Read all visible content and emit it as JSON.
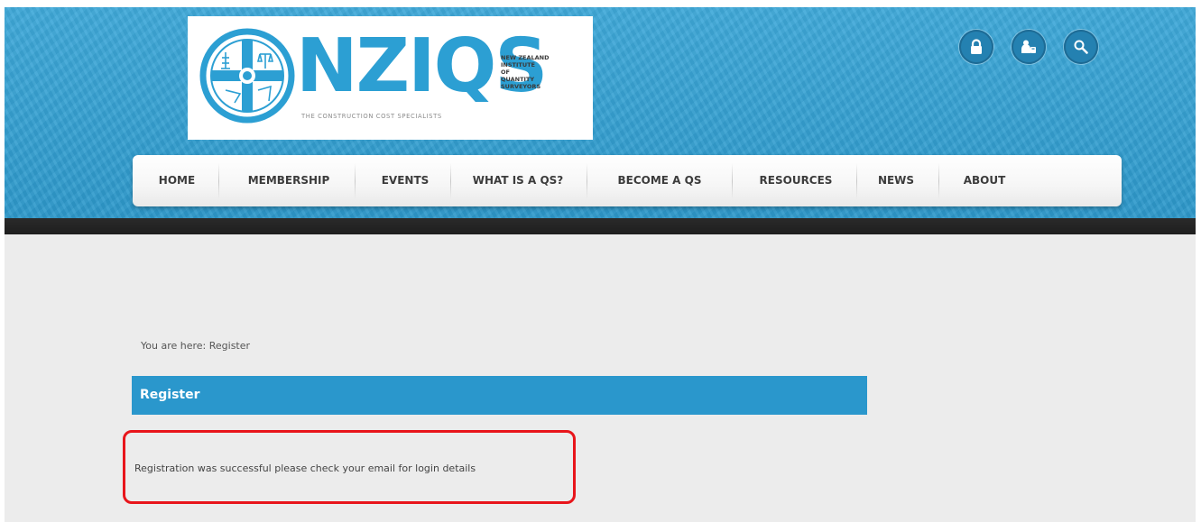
{
  "logo": {
    "wordmark": "NZIQS",
    "side_text": [
      "NEW ZEALAND",
      "INSTITUTE",
      "OF",
      "QUANTITY",
      "SURVEYORS"
    ],
    "tagline": "THE CONSTRUCTION COST SPECIALISTS",
    "brand_color": "#2c9fd3"
  },
  "header_icons": [
    {
      "icon": "lock-icon"
    },
    {
      "icon": "member-icon"
    },
    {
      "icon": "search-icon"
    }
  ],
  "nav": {
    "items": [
      "HOME",
      "MEMBERSHIP",
      "EVENTS",
      "WHAT IS A QS?",
      "BECOME A QS",
      "RESOURCES",
      "NEWS",
      "ABOUT"
    ]
  },
  "breadcrumb": "You are here: Register",
  "page": {
    "title": "Register",
    "message": "Registration was successful please check your email for login details"
  },
  "colors": {
    "header_blue": "#3fa9d9",
    "heading_bar": "#2a97cc",
    "icon_circle": "#2481b1",
    "highlight_red": "#e8151b",
    "page_bg": "#ececec"
  }
}
